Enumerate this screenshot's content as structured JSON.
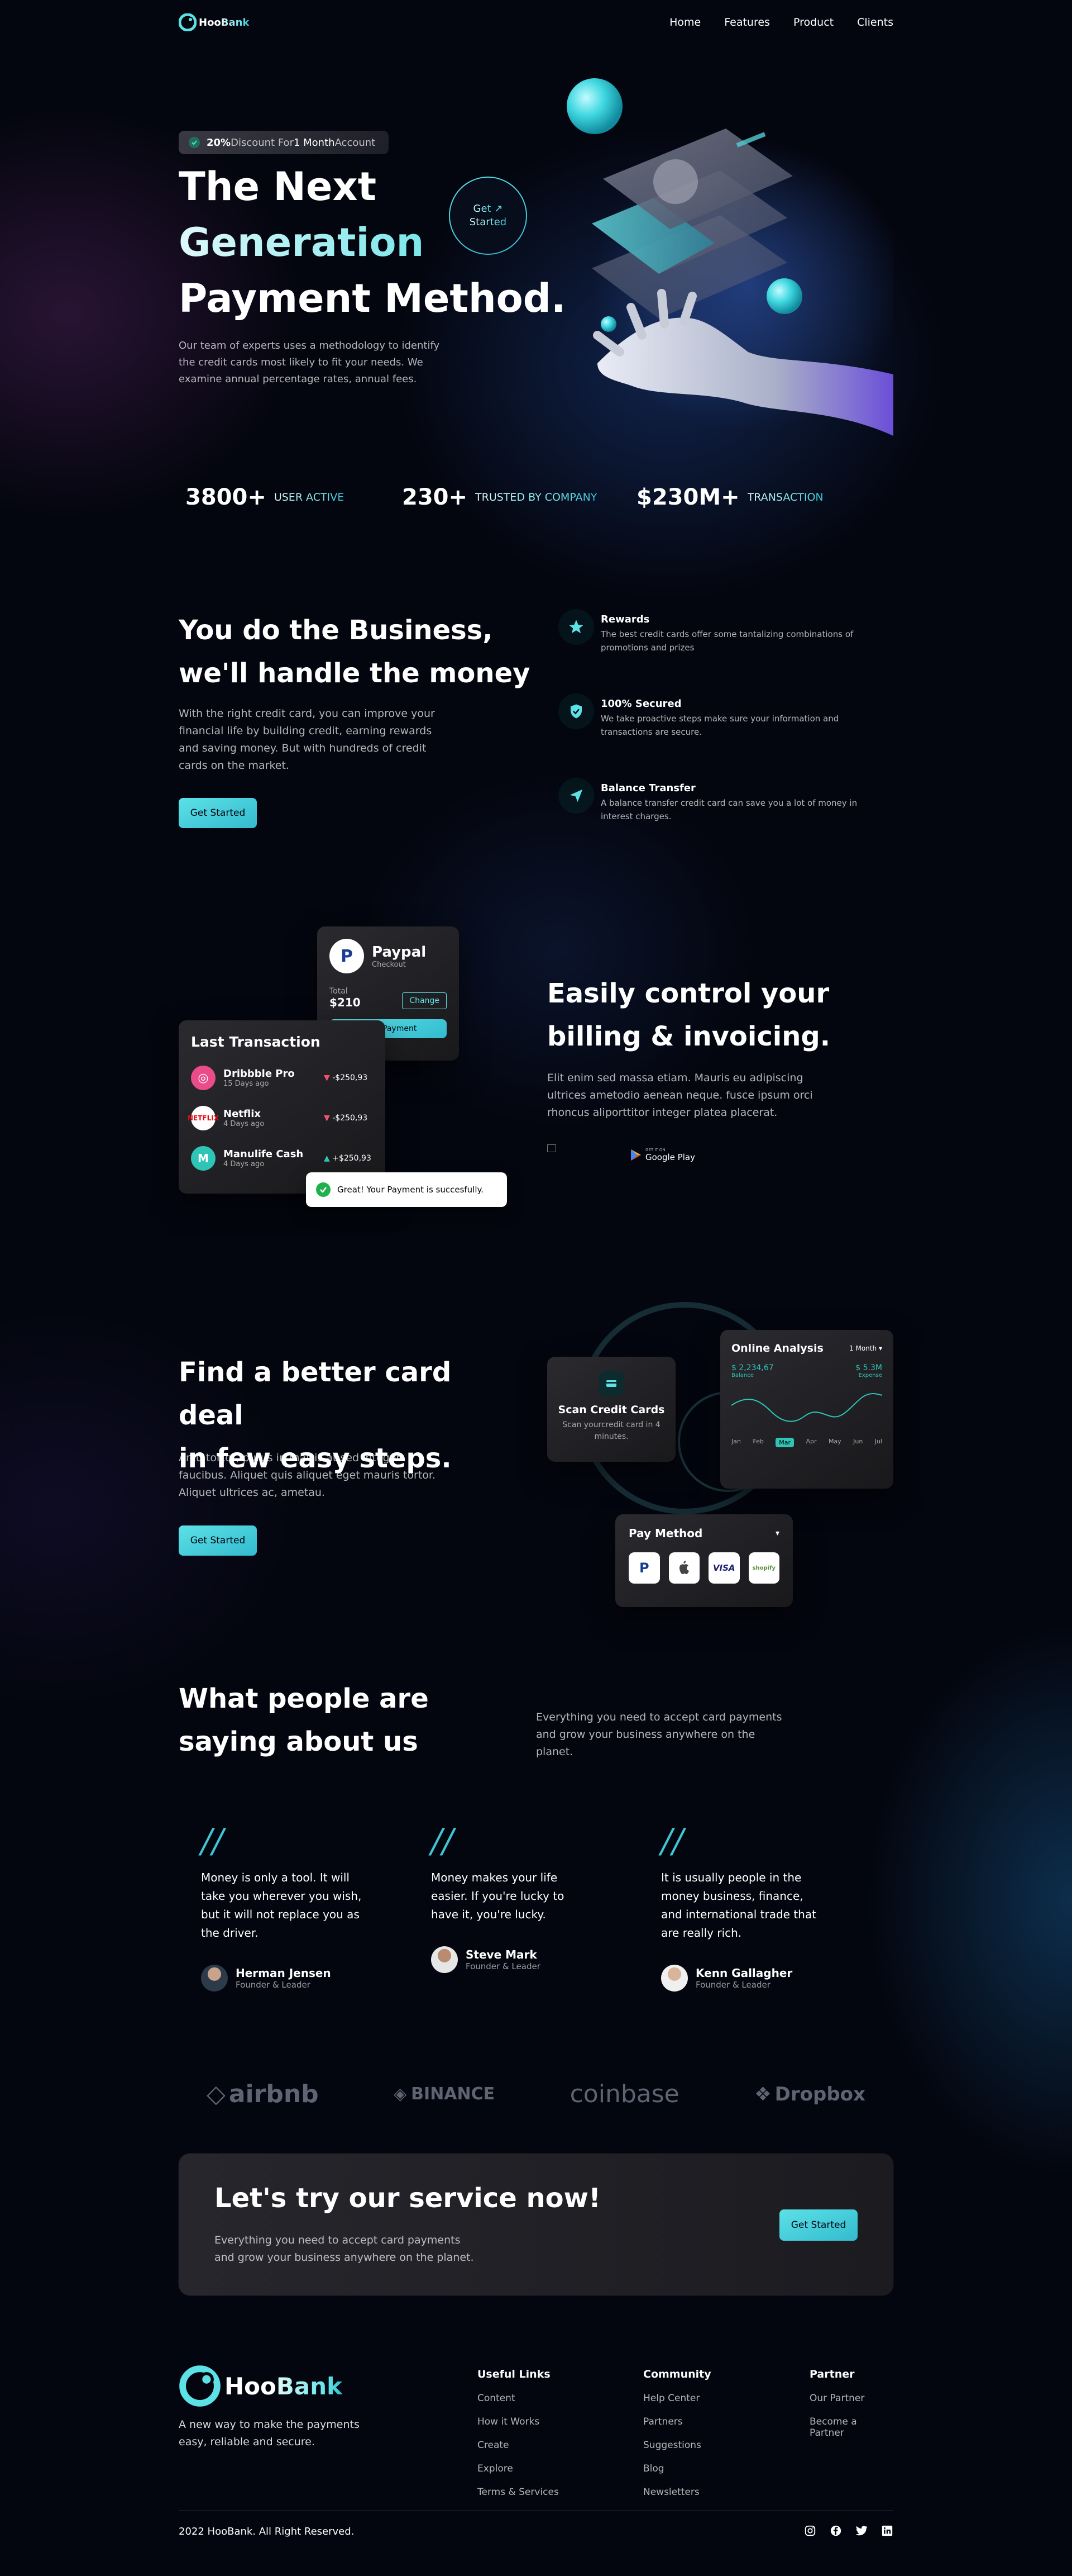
{
  "brand": {
    "name_part1": "Hoo",
    "name_part2": "Bank"
  },
  "nav": {
    "items": [
      "Home",
      "Features",
      "Product",
      "Clients"
    ]
  },
  "hero": {
    "badge_percent": "20%",
    "badge_text1": " Discount For ",
    "badge_highlight": "1 Month",
    "badge_text2": " Account",
    "title_line1": "The Next",
    "title_line2": "Generation",
    "title_line3": "Payment Method.",
    "get_started_line1": "Get",
    "get_started_line2": "Started",
    "description": "Our team of experts uses a methodology to identify the credit cards most likely to fit your needs. We examine annual percentage rates, annual fees."
  },
  "stats": [
    {
      "value": "3800+",
      "label": "USER ACTIVE"
    },
    {
      "value": "230+",
      "label": "TRUSTED BY COMPANY"
    },
    {
      "value": "$230M+",
      "label": "TRANSACTION"
    }
  ],
  "business": {
    "title_line1": "You do the Business,",
    "title_line2": "we'll handle the money",
    "description": "With the right credit card, you can improve your financial life by building credit, earning rewards and saving money. But with hundreds of credit cards on the market.",
    "button": "Get Started",
    "features": [
      {
        "icon": "star-icon",
        "title": "Rewards",
        "text": "The best credit cards offer some tantalizing combinations of promotions and prizes"
      },
      {
        "icon": "shield-icon",
        "title": "100% Secured",
        "text": "We take proactive steps make sure your information and transactions are secure."
      },
      {
        "icon": "send-icon",
        "title": "Balance Transfer",
        "text": "A balance transfer credit card can save you a lot of money in interest charges."
      }
    ]
  },
  "billing": {
    "paypal": {
      "name": "Paypal",
      "sub": "Checkout",
      "total_label": "Total",
      "total": "$210",
      "change": "Change",
      "make_payment": "Make Payment"
    },
    "transactions_title": "Last Transaction",
    "transactions": [
      {
        "icon": "dribbble-icon",
        "name": "Dribbble Pro",
        "time": "15 Days ago",
        "amount": "-$250,93",
        "dir": "down"
      },
      {
        "icon": "netflix-icon",
        "name": "Netflix",
        "time": "4 Days ago",
        "amount": "-$250,93",
        "dir": "down"
      },
      {
        "icon": "manulife-icon",
        "name": "Manulife Cash",
        "time": "4 Days ago",
        "amount": "+$250,93",
        "dir": "up"
      }
    ],
    "toast": "Great! Your Payment is succesfully.",
    "title_line1": "Easily control your",
    "title_line2": "billing & invoicing.",
    "description": "Elit enim sed massa etiam. Mauris eu adipiscing ultrices ametodio aenean neque. fusce ipsum orci rhoncus aliporttitor integer platea placerat.",
    "gplay_small": "GET IT ON",
    "gplay": "Google Play"
  },
  "carddeal": {
    "title_line1": "Find a better card deal",
    "title_line2": "in few easy steps.",
    "description": "Arcu tortor, purus in mattis at sed integer faucibus. Aliquet quis aliquet eget mauris tortor. Aliquet ultrices ac, ametau.",
    "button": "Get Started",
    "scan": {
      "title": "Scan Credit Cards",
      "text": "Scan yourcredit card in 4 minutes."
    },
    "analysis": {
      "title": "Online Analysis",
      "period": "1 Month",
      "income_value": "$ 2,234,67",
      "income_label": "Balance",
      "expense_value": "$ 5.3M",
      "expense_label": "Expense",
      "months": [
        "Jan",
        "Feb",
        "Mar",
        "Apr",
        "May",
        "Jun",
        "Jul"
      ],
      "active_month": "Mar"
    },
    "paymethod": {
      "title": "Pay Method",
      "methods": [
        "P",
        "",
        "VISA",
        "shopify"
      ]
    }
  },
  "testimonials": {
    "title_line1": "What people are",
    "title_line2": "saying about us",
    "description": "Everything you need to accept card payments and grow your business anywhere on the planet.",
    "items": [
      {
        "quote": "Money is only a tool. It will take you wherever you wish, but it will not replace you as the driver.",
        "name": "Herman Jensen",
        "role": "Founder & Leader"
      },
      {
        "quote": "Money makes your life easier. If you're lucky to have it, you're lucky.",
        "name": "Steve Mark",
        "role": "Founder & Leader"
      },
      {
        "quote": "It is usually people in the money business, finance, and international trade that are really rich.",
        "name": "Kenn Gallagher",
        "role": "Founder & Leader"
      }
    ]
  },
  "clients": [
    "airbnb",
    "BINANCE",
    "coinbase",
    "Dropbox"
  ],
  "cta": {
    "title": "Let's try our service now!",
    "description": "Everything you need to accept card payments and grow your business anywhere on the planet.",
    "button": "Get Started"
  },
  "footer": {
    "tagline": "A new way to make the payments easy, reliable and secure.",
    "columns": [
      {
        "title": "Useful Links",
        "links": [
          "Content",
          "How it Works",
          "Create",
          "Explore",
          "Terms & Services"
        ]
      },
      {
        "title": "Community",
        "links": [
          "Help Center",
          "Partners",
          "Suggestions",
          "Blog",
          "Newsletters"
        ]
      },
      {
        "title": "Partner",
        "links": [
          "Our Partner",
          "Become a Partner"
        ]
      }
    ],
    "copyright": "2022 HooBank. All Right Reserved.",
    "social": [
      "instagram-icon",
      "facebook-icon",
      "twitter-icon",
      "linkedin-icon"
    ]
  },
  "colors": {
    "accent": "#5ce1e6",
    "accent2": "#33bbcf",
    "bg": "#00040f",
    "negative": "#f4516c",
    "positive": "#2ec4b6"
  }
}
